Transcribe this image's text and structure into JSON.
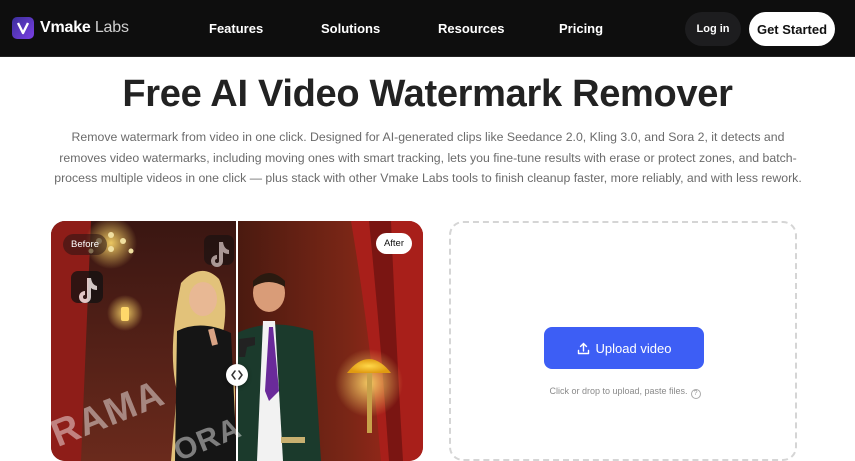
{
  "nav": {
    "brand_name": "Vmake",
    "brand_suffix": "Labs",
    "links": [
      "Features",
      "Solutions",
      "Resources",
      "Pricing"
    ],
    "login_label": "Log in",
    "cta_label": "Get Started"
  },
  "hero": {
    "title": "Free AI Video Watermark Remover",
    "description": "Remove watermark from video in one click. Designed for AI-generated clips like Seedance 2.0, Kling 3.0, and Sora 2, it detects and removes video watermarks, including moving ones with smart tracking, lets you fine-tune results with erase or protect zones, and batch-process multiple videos in one click — plus stack with other Vmake Labs tools to finish cleanup faster, more reliably, and with less rework."
  },
  "compare": {
    "before_label": "Before",
    "after_label": "After",
    "watermark_text": "RAMA",
    "watermark_text_2": "ORA",
    "handle_icon": "split-arrows-icon",
    "watermark_icon": "tiktok-icon"
  },
  "upload": {
    "button_label": "Upload video",
    "button_icon": "upload-icon",
    "hint": "Click or drop to upload, paste files.",
    "help_icon": "help-icon"
  },
  "colors": {
    "nav_bg": "#0e0e0e",
    "accent": "#3d5ef5",
    "brand_gradient": [
      "#3b2f9b",
      "#7b3fe4"
    ]
  }
}
